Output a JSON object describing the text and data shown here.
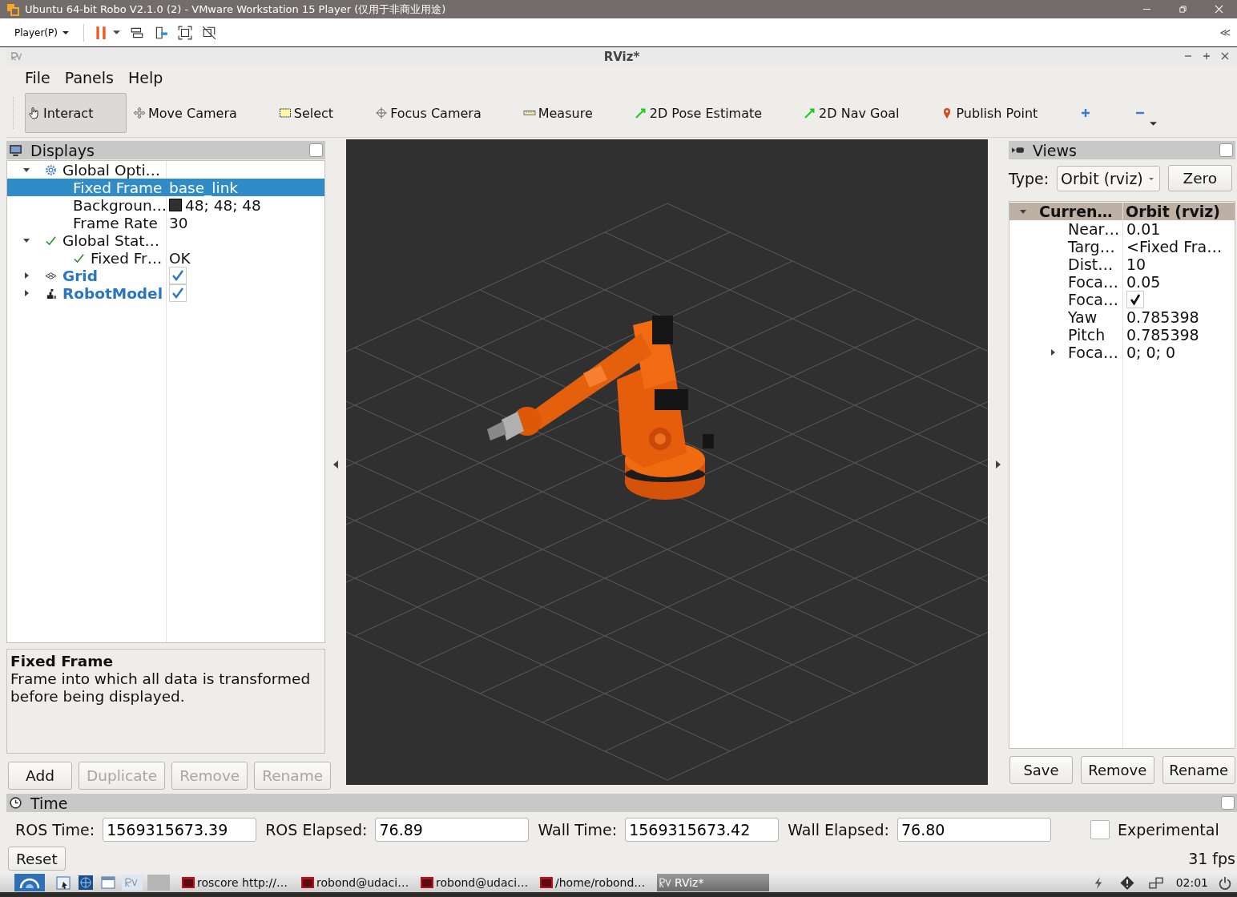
{
  "vm_window": {
    "title": "Ubuntu 64-bit Robo V2.1.0 (2) - VMware Workstation 15 Player (仅用于非商业用途)"
  },
  "vm_toolbar": {
    "player_menu": "Player(P)",
    "collapse": "≪"
  },
  "rviz_window": {
    "title": "RViz*"
  },
  "menu": [
    "File",
    "Panels",
    "Help"
  ],
  "tools": [
    {
      "label": "Interact",
      "kind": "interact",
      "selected": true
    },
    {
      "label": "Move Camera",
      "kind": "move-camera",
      "selected": false
    },
    {
      "label": "Select",
      "kind": "select",
      "selected": false
    },
    {
      "label": "Focus Camera",
      "kind": "focus-camera",
      "selected": false
    },
    {
      "label": "Measure",
      "kind": "measure",
      "selected": false
    },
    {
      "label": "2D Pose Estimate",
      "kind": "pose",
      "selected": false
    },
    {
      "label": "2D Nav Goal",
      "kind": "pose",
      "selected": false
    },
    {
      "label": "Publish Point",
      "kind": "point",
      "selected": false
    },
    {
      "kind": "add",
      "selected": false
    },
    {
      "kind": "remove",
      "selected": false
    }
  ],
  "displays": {
    "title": "Displays",
    "tree": [
      {
        "name": "Global Opti…",
        "kind": "options",
        "expanded": true,
        "selected": false,
        "children": [
          {
            "name": "Fixed Frame",
            "value": "base_link",
            "kind": "property",
            "selected": true
          },
          {
            "name": "Backgroun…",
            "value": "48; 48; 48",
            "kind": "color",
            "selected": false
          },
          {
            "name": "Frame Rate",
            "value": "30",
            "kind": "property",
            "selected": false
          }
        ]
      },
      {
        "name": "Global Stat…",
        "kind": "status",
        "expanded": true,
        "selected": false,
        "children": [
          {
            "name": "Fixed Fr…",
            "value": "OK",
            "kind": "status",
            "selected": false
          }
        ]
      },
      {
        "name": "Grid",
        "kind": "grid-display",
        "expanded": false,
        "checked": true,
        "selected": false
      },
      {
        "name": "RobotModel",
        "kind": "robot-display",
        "expanded": false,
        "checked": true,
        "selected": false
      }
    ],
    "description": {
      "title": "Fixed Frame",
      "text": "Frame into which all data is transformed before being displayed."
    },
    "buttons": [
      {
        "label": "Add",
        "disabled": false
      },
      {
        "label": "Duplicate",
        "disabled": true
      },
      {
        "label": "Remove",
        "disabled": true
      },
      {
        "label": "Rename",
        "disabled": true
      }
    ]
  },
  "views": {
    "title": "Views",
    "type_label": "Type:",
    "type_value": "Orbit (rviz)",
    "zero": "Zero",
    "header": {
      "name": "Curren…",
      "value": "Orbit (rviz)",
      "expanded": true
    },
    "properties": [
      {
        "name": "Near…",
        "value": "0.01",
        "kind": "text"
      },
      {
        "name": "Targ…",
        "value": "<Fixed Fra…",
        "kind": "text"
      },
      {
        "name": "Dist…",
        "value": "10",
        "kind": "text"
      },
      {
        "name": "Foca…",
        "value": "0.05",
        "kind": "text"
      },
      {
        "name": "Foca…",
        "kind": "checkbox",
        "checked": true
      },
      {
        "name": "Yaw",
        "value": "0.785398",
        "kind": "text"
      },
      {
        "name": "Pitch",
        "value": "0.785398",
        "kind": "text"
      },
      {
        "name": "Foca…",
        "value": "0; 0; 0",
        "kind": "text",
        "expanded": false
      }
    ],
    "buttons": [
      "Save",
      "Remove",
      "Rename"
    ]
  },
  "time": {
    "title": "Time",
    "fields": [
      {
        "label": "ROS Time:",
        "value": "1569315673.39"
      },
      {
        "label": "ROS Elapsed:",
        "value": "76.89"
      },
      {
        "label": "Wall Time:",
        "value": "1569315673.42"
      },
      {
        "label": "Wall Elapsed:",
        "value": "76.80"
      }
    ],
    "experimental": {
      "label": "Experimental",
      "checked": false
    },
    "reset": "Reset",
    "fps": "31 fps"
  },
  "taskbar": {
    "tasks": [
      {
        "label": "roscore http://…",
        "kind": "terminal",
        "selected": false
      },
      {
        "label": "robond@udaci…",
        "kind": "terminal",
        "selected": false
      },
      {
        "label": "robond@udaci…",
        "kind": "terminal",
        "selected": false
      },
      {
        "label": "/home/robond…",
        "kind": "terminal",
        "selected": false
      },
      {
        "label": "RViz*",
        "kind": "rviz",
        "selected": true
      }
    ],
    "clock": "02:01"
  }
}
